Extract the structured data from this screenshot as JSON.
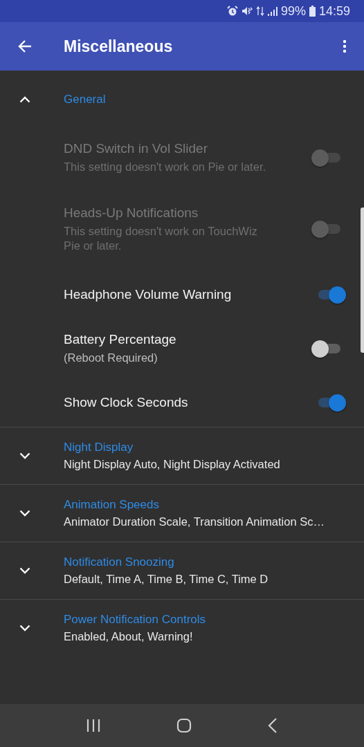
{
  "status_bar": {
    "battery": "99%",
    "time": "14:59"
  },
  "app_bar": {
    "title": "Miscellaneous"
  },
  "groups": [
    {
      "title": "General",
      "expanded": true,
      "items": [
        {
          "title": "DND Switch in Vol Slider",
          "subtitle": "This setting doesn't work on Pie or later.",
          "disabled": true,
          "on": false
        },
        {
          "title": "Heads-Up Notifications",
          "subtitle": "This setting doesn't work on TouchWiz Pie or later.",
          "disabled": true,
          "on": false
        },
        {
          "title": "Headphone Volume Warning",
          "disabled": false,
          "on": true
        },
        {
          "title": "Battery Percentage",
          "subtitle": "(Reboot Required)",
          "disabled": false,
          "on": false
        },
        {
          "title": "Show Clock Seconds",
          "disabled": false,
          "on": true
        }
      ]
    },
    {
      "title": "Night Display",
      "expanded": false,
      "summary": "Night Display Auto, Night Display Activated"
    },
    {
      "title": "Animation Speeds",
      "expanded": false,
      "summary": "Animator Duration Scale, Transition Animation Sc…"
    },
    {
      "title": "Notification Snoozing",
      "expanded": false,
      "summary": "Default, Time A, Time B, Time C, Time D"
    },
    {
      "title": "Power Notification Controls",
      "expanded": false,
      "summary": "Enabled, About, Warning!"
    }
  ]
}
